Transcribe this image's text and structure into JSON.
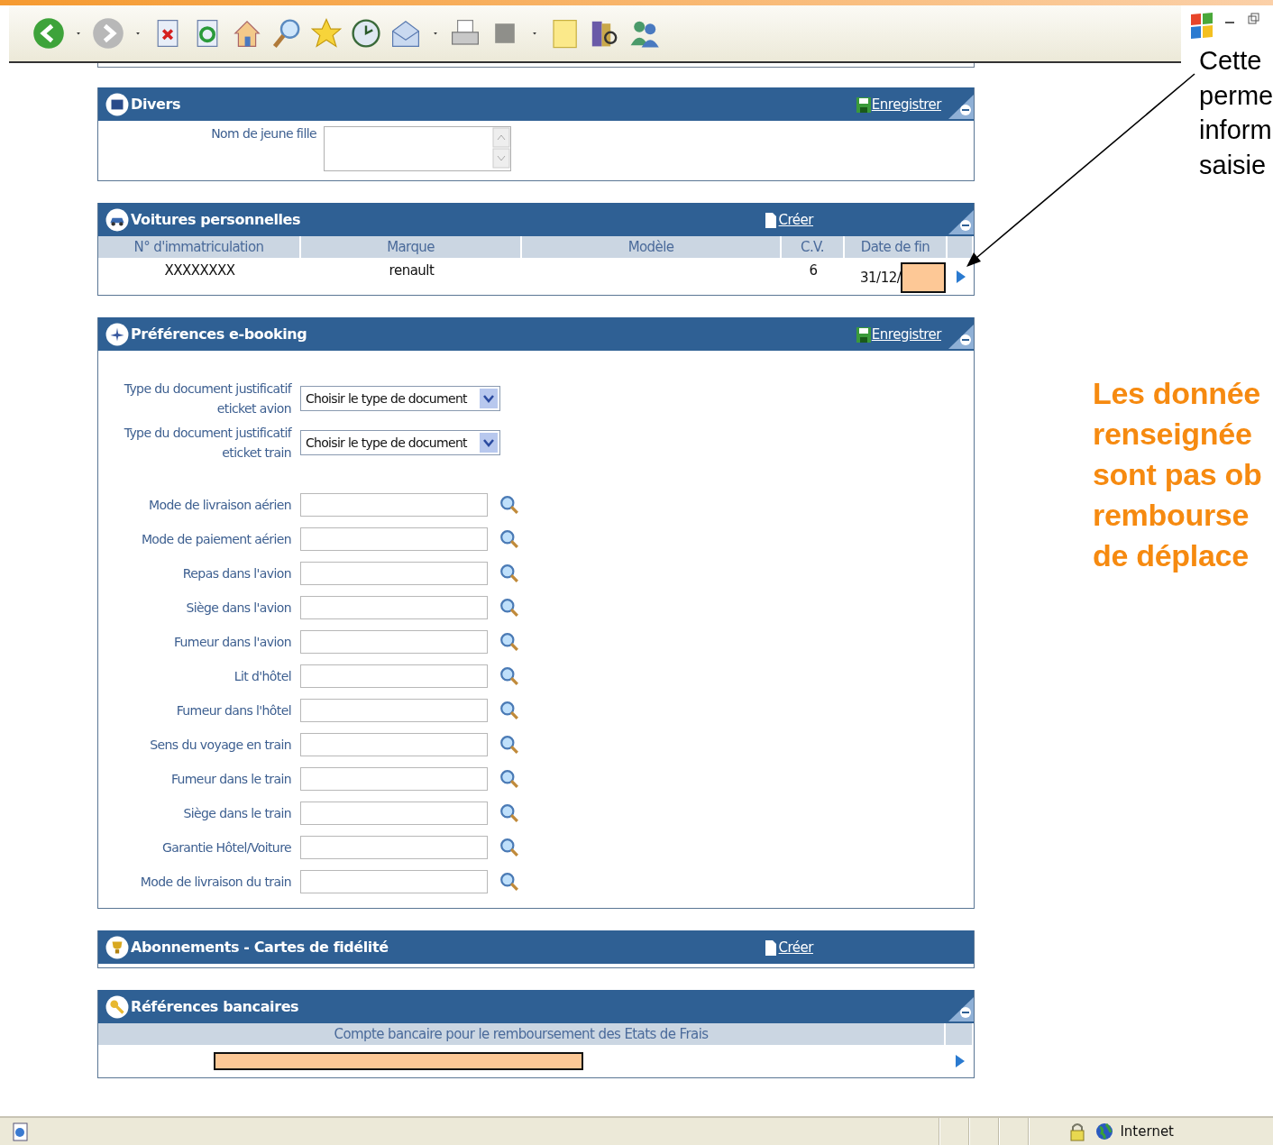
{
  "panels": [
    {
      "kind": "form",
      "title": "Divers",
      "action": {
        "kind": "save",
        "label": "Enregistrer"
      },
      "collapsible": true,
      "fields": [
        {
          "label": "Nom de jeune fille"
        }
      ]
    },
    {
      "kind": "table",
      "title": "Voitures personnelles",
      "action": {
        "kind": "create",
        "label": "Créer"
      },
      "collapsible": true,
      "columns": [
        "N° d'immatriculation",
        "Marque",
        "Modèle",
        "C.V.",
        "Date de fin"
      ],
      "rows": [
        {
          "immatriculation": "XXXXXXXX",
          "marque": "renault",
          "cv": "6",
          "date_fin": "31/12/"
        }
      ]
    },
    {
      "kind": "preferences",
      "title": "Préférences e-booking",
      "action": {
        "kind": "save",
        "label": "Enregistrer"
      },
      "collapsible": true,
      "selects": [
        {
          "label": [
            "Type du document justificatif",
            "eticket avion"
          ],
          "value": "Choisir le type de document"
        },
        {
          "label": [
            "Type du document justificatif",
            "eticket train"
          ],
          "value": "Choisir le type de document"
        }
      ],
      "lookups": [
        "Mode de livraison aérien",
        "Mode de paiement aérien",
        "Repas dans l'avion",
        "Siège dans l'avion",
        "Fumeur dans l'avion",
        "Lit d'hôtel",
        "Fumeur dans l'hôtel",
        "Sens du voyage en train",
        "Fumeur dans le train",
        "Siège dans le train",
        "Garantie Hôtel/Voiture",
        "Mode de livraison du train"
      ]
    },
    {
      "kind": "empty",
      "title": "Abonnements - Cartes de fidélité",
      "action": {
        "kind": "create",
        "label": "Créer"
      },
      "collapsible": false
    },
    {
      "kind": "bank",
      "title": "Références bancaires",
      "collapsible": true,
      "columns": [
        "Compte bancaire pour le remboursement des Etats de Frais"
      ]
    }
  ],
  "callout": [
    "Cette",
    "perme",
    "inform",
    "saisie"
  ],
  "note": [
    "Les donnée",
    "renseignée",
    "sont pas ob",
    "rembourse",
    "de déplace"
  ],
  "status_bar": {
    "zone": "Internet"
  }
}
